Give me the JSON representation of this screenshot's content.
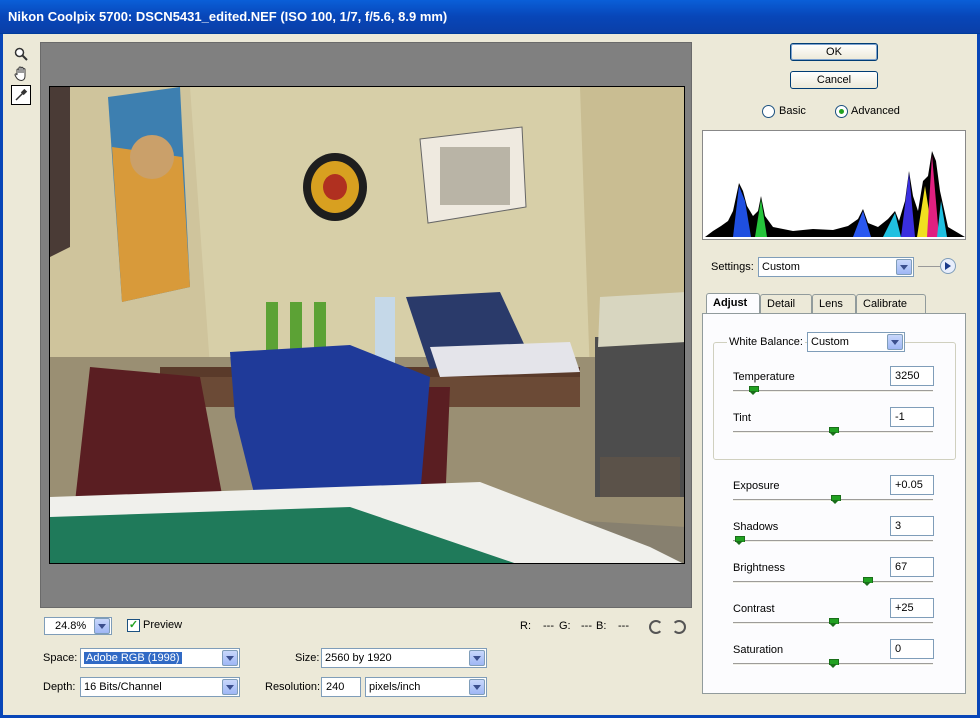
{
  "window": {
    "title": "Nikon Coolpix 5700:  DSCN5431_edited.NEF  (ISO 100, 1/7, f/5.6, 8.9 mm)"
  },
  "tools": [
    {
      "name": "zoom-tool",
      "icon": "magnifier-icon"
    },
    {
      "name": "hand-tool",
      "icon": "hand-icon"
    },
    {
      "name": "white-balance-tool",
      "icon": "eyedropper-icon"
    }
  ],
  "status": {
    "zoom": "24.8%",
    "preview_label": "Preview",
    "preview_checked": true,
    "r_label": "R:",
    "r_value": "---",
    "g_label": "G:",
    "g_value": "---",
    "b_label": "B:",
    "b_value": "---"
  },
  "workflow": {
    "space_label": "Space:",
    "space_value": "Adobe RGB (1998)",
    "depth_label": "Depth:",
    "depth_value": "16 Bits/Channel",
    "size_label": "Size:",
    "size_value": "2560 by 1920",
    "resolution_label": "Resolution:",
    "resolution_value": "240",
    "resolution_unit": "pixels/inch"
  },
  "actions": {
    "ok": "OK",
    "cancel": "Cancel"
  },
  "mode": {
    "basic": "Basic",
    "advanced": "Advanced",
    "selected": "Advanced"
  },
  "settings": {
    "label": "Settings:",
    "value": "Custom"
  },
  "tabs": [
    "Adjust",
    "Detail",
    "Lens",
    "Calibrate"
  ],
  "active_tab": "Adjust",
  "adjust": {
    "white_balance_label": "White Balance:",
    "white_balance_value": "Custom",
    "sliders": [
      {
        "label": "Temperature",
        "value": "3250",
        "position": 0.1
      },
      {
        "label": "Tint",
        "value": "-1",
        "position": 0.5
      },
      {
        "label": "Exposure",
        "value": "+0.05",
        "position": 0.51
      },
      {
        "label": "Shadows",
        "value": "3",
        "position": 0.03
      },
      {
        "label": "Brightness",
        "value": "67",
        "position": 0.67
      },
      {
        "label": "Contrast",
        "value": "+25",
        "position": 0.5
      },
      {
        "label": "Saturation",
        "value": "0",
        "position": 0.5
      }
    ]
  },
  "colors": {
    "title_bar": "#0a5fd8",
    "selection": "#316ac5",
    "thumb": "#21a121"
  }
}
